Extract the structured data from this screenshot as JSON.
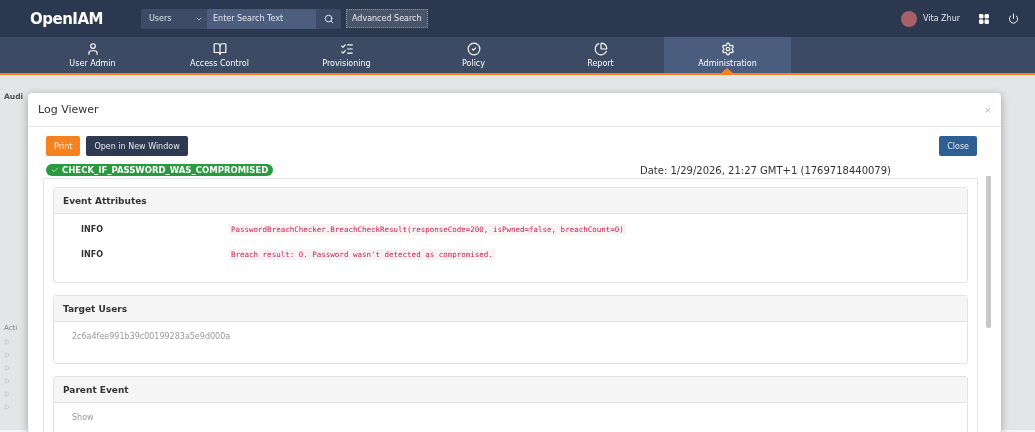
{
  "header": {
    "logo": "OpenIAM",
    "search": {
      "scope": "Users",
      "placeholder": "Enter Search Text",
      "advanced": "Advanced Search"
    },
    "user": {
      "name": "Vita Zhur"
    }
  },
  "nav": [
    {
      "label": "User Admin",
      "selected": false
    },
    {
      "label": "Access Control",
      "selected": false
    },
    {
      "label": "Provisioning",
      "selected": false
    },
    {
      "label": "Policy",
      "selected": false
    },
    {
      "label": "Report",
      "selected": false
    },
    {
      "label": "Administration",
      "selected": true
    }
  ],
  "background": {
    "title": "Audi",
    "table_header": "Acti"
  },
  "modal": {
    "title": "Log Viewer",
    "close_symbol": "×",
    "buttons": [
      {
        "label": "Print",
        "kind": "primary"
      },
      {
        "label": "Open in New Window",
        "kind": "dark"
      }
    ],
    "close_button": "Close",
    "badge": {
      "label": "CHECK_IF_PASSWORD_WAS_COMPROMISED",
      "success": true
    },
    "date": "Date: 1/29/2026, 21:27 GMT+1 (1769718440079)",
    "sections": [
      {
        "title": "Event Attributes",
        "kind": "attributes",
        "rows": [
          {
            "level": "INFO",
            "message": "PasswordBreachChecker.BreachCheckResult(responseCode=200, isPwned=false, breachCount=0)"
          },
          {
            "level": "INFO",
            "message": "Breach result: 0. Password wasn't detected as compromised."
          }
        ]
      },
      {
        "title": "Target Users",
        "kind": "text",
        "text": "2c6a4fee991b39c00199283a5e9d000a"
      },
      {
        "title": "Parent Event",
        "kind": "text",
        "text": "Show"
      }
    ]
  }
}
